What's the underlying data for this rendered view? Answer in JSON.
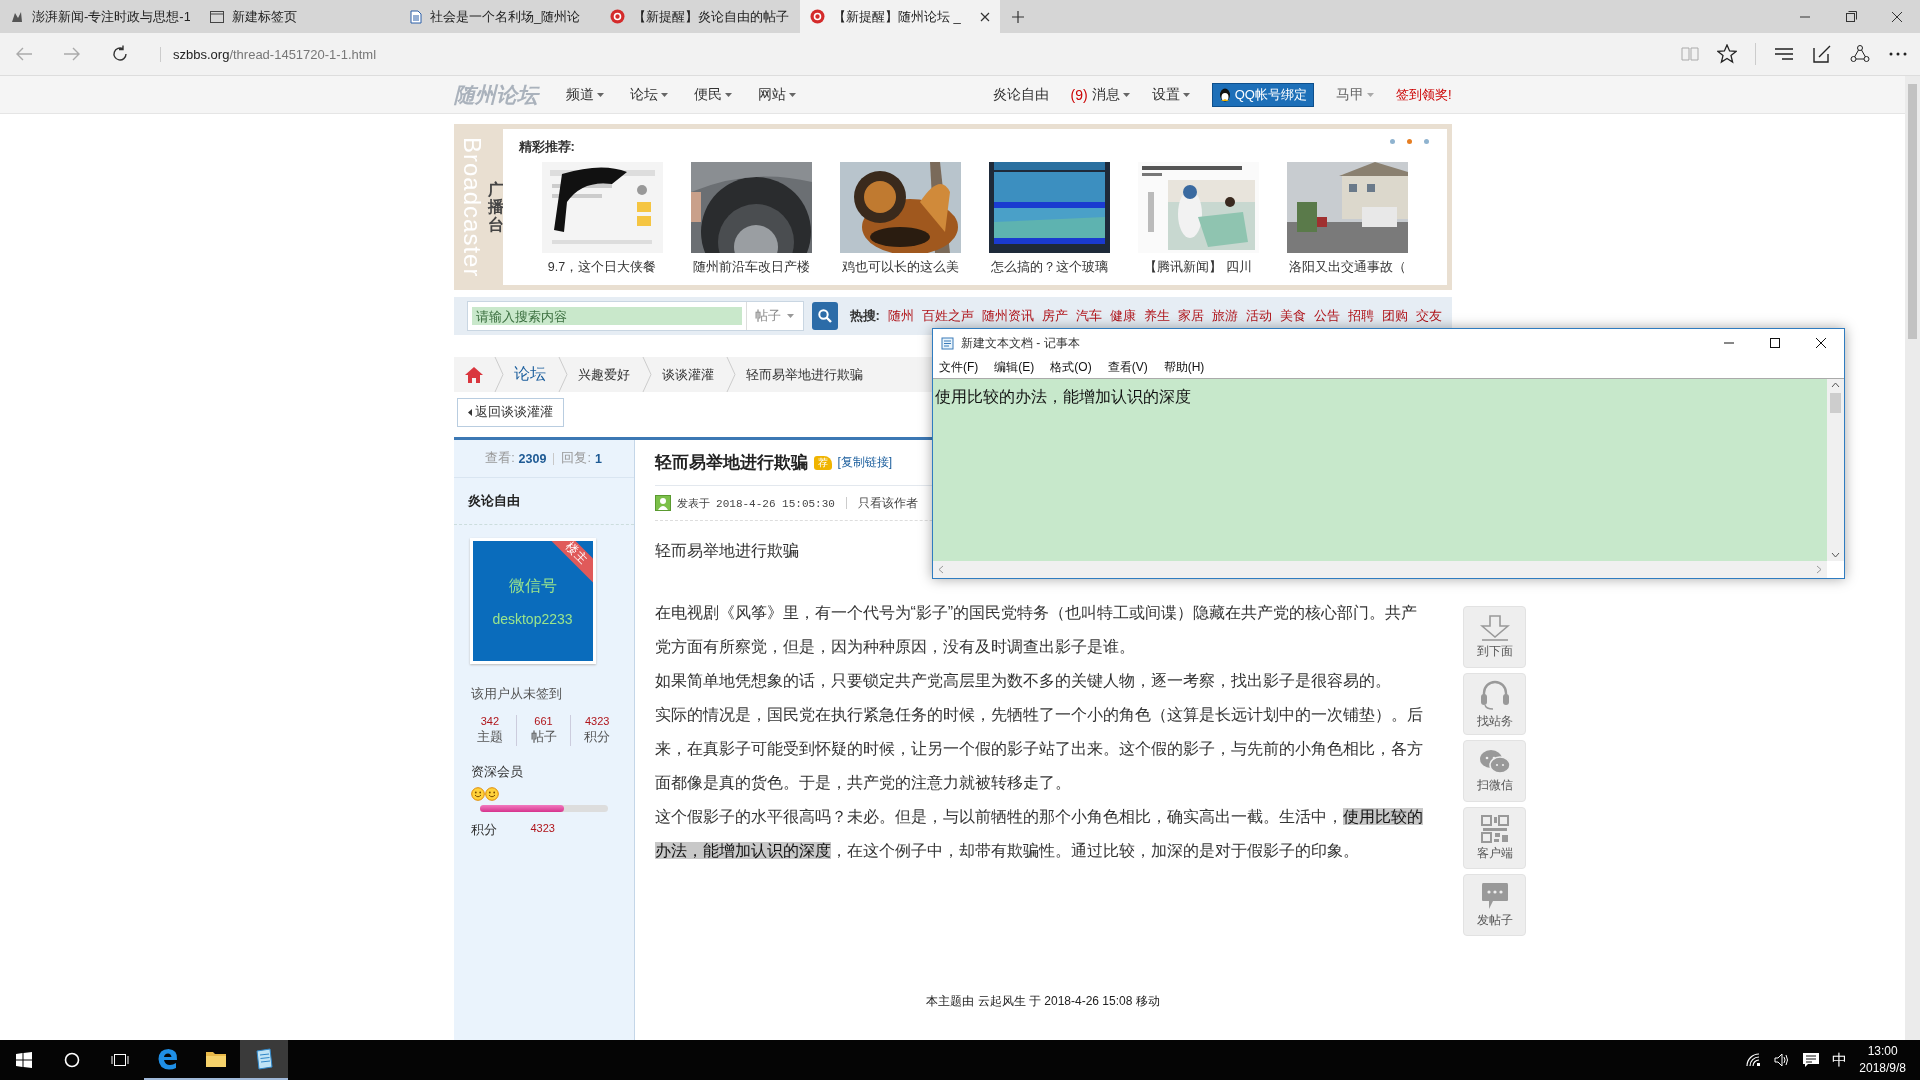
{
  "browser": {
    "tabs": [
      {
        "title": "澎湃新闻-专注时政与思想-1",
        "selected": false,
        "kind": "news"
      },
      {
        "title": "新建标签页",
        "selected": false,
        "kind": "blank"
      },
      {
        "title": "社会是一个名利场_随州论",
        "selected": false,
        "kind": "doc"
      },
      {
        "title": "【新提醒】炎论自由的帖子",
        "selected": false,
        "kind": "forum"
      },
      {
        "title": "【新提醒】随州论坛 _",
        "selected": true,
        "kind": "forum"
      }
    ],
    "url_host": "szbbs.org",
    "url_path": "/thread-1451720-1-1.html"
  },
  "forum_nav": {
    "logo": "随州论坛",
    "menus": [
      "频道",
      "论坛",
      "便民",
      "网站"
    ],
    "username": "炎论自由",
    "message_count": "(9)",
    "messages": "消息",
    "settings": "设置",
    "qq_bind": "QQ帐号绑定",
    "alt_account": "马甲",
    "checkin": "签到领奖!"
  },
  "broadcaster": {
    "side_latin": "Broadcaster",
    "side_label": "广播台",
    "title": "精彩推荐:",
    "dots": [
      {
        "selected": false
      },
      {
        "selected": true
      },
      {
        "selected": false
      }
    ],
    "items": [
      {
        "caption": "9.7，这个日大侠餐"
      },
      {
        "caption": "随州前沿车改日产楼"
      },
      {
        "caption": "鸡也可以长的这么美"
      },
      {
        "caption": "怎么搞的？这个玻璃"
      },
      {
        "caption": "【腾讯新闻】 四川"
      },
      {
        "caption": "洛阳又出交通事故（"
      }
    ]
  },
  "search": {
    "placeholder": "请输入搜索内容",
    "scope": "帖子",
    "hot_label": "热搜:",
    "hot_words": [
      "随州",
      "百姓之声",
      "随州资讯",
      "房产",
      "汽车",
      "健康",
      "养生",
      "家居",
      "旅游",
      "活动",
      "美食",
      "公告",
      "招聘",
      "团购",
      "交友"
    ]
  },
  "breadcrumb": [
    "论坛",
    "兴趣爱好",
    "谈谈灌灌",
    "轻而易举地进行欺骗"
  ],
  "back_button": "返回谈谈灌灌",
  "post": {
    "views_label": "查看:",
    "views": "2309",
    "replies_label": "回复:",
    "replies": "1",
    "author": "炎论自由",
    "avatar_line1": "微信号",
    "avatar_line2": "desktop2233",
    "owner_badge": "楼主",
    "signin": "该用户从未签到",
    "stats": [
      {
        "value": "342",
        "label": "主题"
      },
      {
        "value": "661",
        "label": "帖子"
      },
      {
        "value": "4323",
        "label": "积分"
      }
    ],
    "rank": "资深会员",
    "level": 0.66,
    "points_label": "积分",
    "points": "4323",
    "title": "轻而易举地进行欺骗",
    "recommend_badge": "荐",
    "copy_link": "[复制链接]",
    "posted": "发表于 2018-4-26 15:05:30",
    "author_only": "只看该作者",
    "subtitle": "轻而易举地进行欺骗",
    "paragraphs": [
      [
        {
          "text": "在电视剧《风筝》里，有一个代号为“影子”的国民党特务（也叫特工或间谍）隐藏在共产党的核心部门。共产党方面有所察觉，但是，因为种种原因，没有及时调查出影子是谁。",
          "highlighted": false
        }
      ],
      [
        {
          "text": "如果简单地凭想象的话，只要锁定共产党高层里为数不多的关键人物，逐一考察，找出影子是很容易的。",
          "highlighted": false
        }
      ],
      [
        {
          "text": "实际的情况是，国民党在执行紧急任务的时候，先牺牲了一个小的角色（这算是长远计划中的一次铺垫）。后来，在真影子可能受到怀疑的时候，让另一个假的影子站了出来。这个假的影子，与先前的小角色相比，各方面都像是真的货色。于是，共产党的注意力就被转移走了。",
          "highlighted": false
        }
      ],
      [
        {
          "text": "这个假影子的水平很高吗？未必。但是，与以前牺牲的那个小角色相比，确实高出一截。生活中，",
          "highlighted": false
        },
        {
          "text": "使用比较的办法，能增加认识的深度",
          "highlighted": true
        },
        {
          "text": "，在这个例子中，却带有欺骗性。通过比较，加深的是对于假影子的印象。",
          "highlighted": false
        }
      ]
    ],
    "move_note": "本主题由 云起风生 于 2018-4-26 15:08 移动"
  },
  "notepad": {
    "title": "新建文本文档 - 记事本",
    "menus": [
      "文件(F)",
      "编辑(E)",
      "格式(O)",
      "查看(V)",
      "帮助(H)"
    ],
    "text": "使用比较的办法，能增加认识的深度"
  },
  "float_buttons": [
    {
      "label": "到下面",
      "kind": "down"
    },
    {
      "label": "找站务",
      "kind": "headset"
    },
    {
      "label": "扫微信",
      "kind": "chat"
    },
    {
      "label": "客户端",
      "kind": "qr"
    },
    {
      "label": "发帖子",
      "kind": "comment"
    }
  ],
  "taskbar": {
    "items": [
      {
        "kind": "start",
        "running": false,
        "selected": false
      },
      {
        "kind": "search",
        "running": false,
        "selected": false
      },
      {
        "kind": "taskview",
        "running": false,
        "selected": false
      },
      {
        "kind": "edge",
        "running": true,
        "selected": false
      },
      {
        "kind": "folder",
        "running": true,
        "selected": false
      },
      {
        "kind": "notepad",
        "running": true,
        "selected": true
      }
    ],
    "ime": "中",
    "time": "13:00",
    "date": "2018/9/8"
  }
}
